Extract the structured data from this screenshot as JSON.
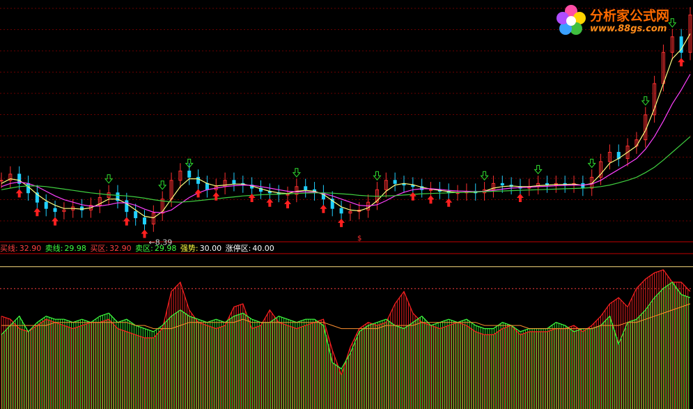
{
  "logo": {
    "name": "分析家公式网",
    "url": "www.88gs.com"
  },
  "status_bar": [
    {
      "label": "买线:",
      "value": "32.90",
      "label_color": "#ff4040",
      "value_color": "#ff4040"
    },
    {
      "label": "卖线:",
      "value": "29.98",
      "label_color": "#40ff40",
      "value_color": "#40ff40"
    },
    {
      "label": "买区:",
      "value": "32.90",
      "label_color": "#ff4040",
      "value_color": "#ff4040"
    },
    {
      "label": "卖区:",
      "value": "29.98",
      "label_color": "#40ff40",
      "value_color": "#40ff40"
    },
    {
      "label": "强势:",
      "value": "30.00",
      "label_color": "#ffff40",
      "value_color": "#ffffff"
    },
    {
      "label": "涨停区:",
      "value": "40.00",
      "label_color": "#ffffff",
      "value_color": "#ffffff"
    }
  ],
  "chart_data": [
    {
      "type": "line",
      "panel": "price",
      "annotations": [
        {
          "text": "8.39",
          "kind": "low_marker"
        },
        {
          "text": "$",
          "kind": "symbol"
        }
      ],
      "series": [
        {
          "key": "close",
          "color": "#ffffff",
          "values": [
            9.9,
            10.1,
            9.8,
            9.5,
            9.2,
            9.0,
            8.9,
            8.95,
            9.05,
            8.95,
            9.1,
            9.35,
            9.5,
            9.25,
            8.9,
            8.7,
            8.5,
            8.85,
            9.3,
            9.9,
            10.2,
            10.0,
            9.8,
            9.6,
            9.7,
            9.9,
            9.8,
            9.75,
            9.65,
            9.55,
            9.5,
            9.45,
            9.45,
            9.7,
            9.6,
            9.5,
            9.3,
            9.0,
            8.85,
            8.9,
            8.95,
            9.2,
            9.6,
            9.9,
            9.8,
            9.75,
            9.7,
            9.6,
            9.6,
            9.55,
            9.5,
            9.5,
            9.55,
            9.5,
            9.6,
            9.8,
            9.75,
            9.7,
            9.65,
            9.7,
            9.8,
            9.75,
            9.8,
            9.75,
            9.8,
            9.65,
            10.0,
            10.5,
            10.8,
            10.6,
            11.0,
            11.2,
            12.0,
            13.0,
            14.0,
            14.5,
            14.0,
            15.2
          ]
        },
        {
          "key": "ma_short",
          "color": "#ffff80",
          "values": [
            9.8,
            9.95,
            9.9,
            9.7,
            9.45,
            9.25,
            9.1,
            9.0,
            9.0,
            8.98,
            9.02,
            9.15,
            9.3,
            9.3,
            9.15,
            8.95,
            8.75,
            8.7,
            8.9,
            9.3,
            9.7,
            9.95,
            9.95,
            9.8,
            9.72,
            9.75,
            9.78,
            9.78,
            9.72,
            9.63,
            9.55,
            9.5,
            9.48,
            9.55,
            9.58,
            9.55,
            9.45,
            9.25,
            9.05,
            8.95,
            8.92,
            9.02,
            9.25,
            9.55,
            9.75,
            9.8,
            9.76,
            9.68,
            9.62,
            9.58,
            9.54,
            9.51,
            9.52,
            9.52,
            9.55,
            9.65,
            9.7,
            9.72,
            9.7,
            9.7,
            9.73,
            9.75,
            9.77,
            9.77,
            9.78,
            9.74,
            9.8,
            10.1,
            10.45,
            10.6,
            10.8,
            11.0,
            11.5,
            12.2,
            13.0,
            13.8,
            14.1,
            14.6
          ]
        },
        {
          "key": "ma_mid",
          "color": "#ff40ff",
          "values": [
            9.7,
            9.8,
            9.85,
            9.8,
            9.7,
            9.55,
            9.4,
            9.28,
            9.2,
            9.12,
            9.07,
            9.08,
            9.12,
            9.18,
            9.18,
            9.1,
            8.98,
            8.88,
            8.86,
            8.95,
            9.15,
            9.35,
            9.5,
            9.6,
            9.65,
            9.7,
            9.73,
            9.75,
            9.74,
            9.7,
            9.65,
            9.6,
            9.55,
            9.53,
            9.53,
            9.52,
            9.48,
            9.4,
            9.3,
            9.2,
            9.1,
            9.08,
            9.12,
            9.25,
            9.4,
            9.52,
            9.6,
            9.63,
            9.63,
            9.61,
            9.58,
            9.56,
            9.55,
            9.54,
            9.55,
            9.58,
            9.62,
            9.65,
            9.67,
            9.68,
            9.7,
            9.71,
            9.73,
            9.74,
            9.75,
            9.75,
            9.78,
            9.9,
            10.08,
            10.25,
            10.42,
            10.6,
            10.9,
            11.3,
            11.8,
            12.35,
            12.8,
            13.3
          ]
        },
        {
          "key": "ma_long",
          "color": "#40d040",
          "values": [
            9.6,
            9.65,
            9.7,
            9.72,
            9.72,
            9.7,
            9.66,
            9.62,
            9.58,
            9.54,
            9.5,
            9.47,
            9.44,
            9.42,
            9.4,
            9.37,
            9.33,
            9.28,
            9.24,
            9.21,
            9.2,
            9.22,
            9.25,
            9.28,
            9.31,
            9.34,
            9.37,
            9.4,
            9.42,
            9.44,
            9.45,
            9.46,
            9.47,
            9.48,
            9.49,
            9.5,
            9.5,
            9.49,
            9.47,
            9.45,
            9.42,
            9.4,
            9.39,
            9.4,
            9.41,
            9.43,
            9.45,
            9.47,
            9.48,
            9.49,
            9.5,
            9.51,
            9.52,
            9.53,
            9.54,
            9.55,
            9.56,
            9.57,
            9.58,
            9.59,
            9.6,
            9.61,
            9.62,
            9.63,
            9.64,
            9.65,
            9.67,
            9.7,
            9.75,
            9.82,
            9.9,
            10.0,
            10.15,
            10.32,
            10.55,
            10.8,
            11.05,
            11.3
          ]
        }
      ]
    },
    {
      "type": "bar",
      "panel": "oscillator",
      "reference_lines": [
        40.0,
        32.9
      ],
      "series": [
        {
          "key": "red_histogram",
          "color": "#e02020",
          "values": [
            24,
            23,
            20,
            19,
            21,
            23,
            22,
            21,
            20,
            21,
            22,
            22,
            23,
            20,
            19,
            18,
            17,
            17,
            20,
            32,
            35,
            26,
            22,
            21,
            20,
            21,
            27,
            28,
            20,
            21,
            26,
            22,
            21,
            20,
            21,
            22,
            23,
            13,
            5,
            14,
            20,
            22,
            21,
            22,
            28,
            32,
            25,
            22,
            21,
            20,
            21,
            22,
            21,
            19,
            18,
            18,
            20,
            21,
            18,
            19,
            19,
            19,
            20,
            20,
            21,
            19,
            21,
            24,
            28,
            30,
            27,
            33,
            36,
            38,
            39,
            35,
            35,
            32
          ]
        },
        {
          "key": "green_histogram",
          "color": "#30e030",
          "values": [
            18,
            21,
            24,
            19,
            22,
            24,
            23,
            23,
            22,
            23,
            22,
            24,
            25,
            22,
            23,
            21,
            20,
            19,
            21,
            24,
            26,
            24,
            23,
            22,
            23,
            22,
            24,
            25,
            23,
            22,
            22,
            24,
            23,
            22,
            23,
            23,
            21,
            9,
            7,
            12,
            19,
            21,
            22,
            23,
            21,
            20,
            22,
            24,
            21,
            22,
            23,
            22,
            23,
            21,
            20,
            20,
            22,
            21,
            19,
            20,
            20,
            20,
            22,
            21,
            19,
            20,
            20,
            21,
            24,
            15,
            22,
            23,
            26,
            30,
            33,
            35,
            31,
            30
          ]
        },
        {
          "key": "signal_line",
          "color": "#ff9030",
          "values": [
            21,
            21,
            21,
            21,
            21,
            21,
            22,
            22,
            22,
            22,
            22,
            22,
            22,
            22,
            22,
            21,
            21,
            20,
            20,
            20,
            21,
            22,
            22,
            22,
            22,
            22,
            22,
            23,
            22,
            22,
            22,
            22,
            22,
            22,
            22,
            22,
            22,
            21,
            20,
            20,
            20,
            20,
            20,
            21,
            21,
            21,
            21,
            22,
            22,
            22,
            22,
            22,
            22,
            22,
            21,
            21,
            21,
            21,
            21,
            20,
            20,
            20,
            20,
            20,
            20,
            20,
            20,
            21,
            21,
            21,
            22,
            22,
            23,
            24,
            25,
            26,
            27,
            28
          ]
        }
      ]
    }
  ]
}
